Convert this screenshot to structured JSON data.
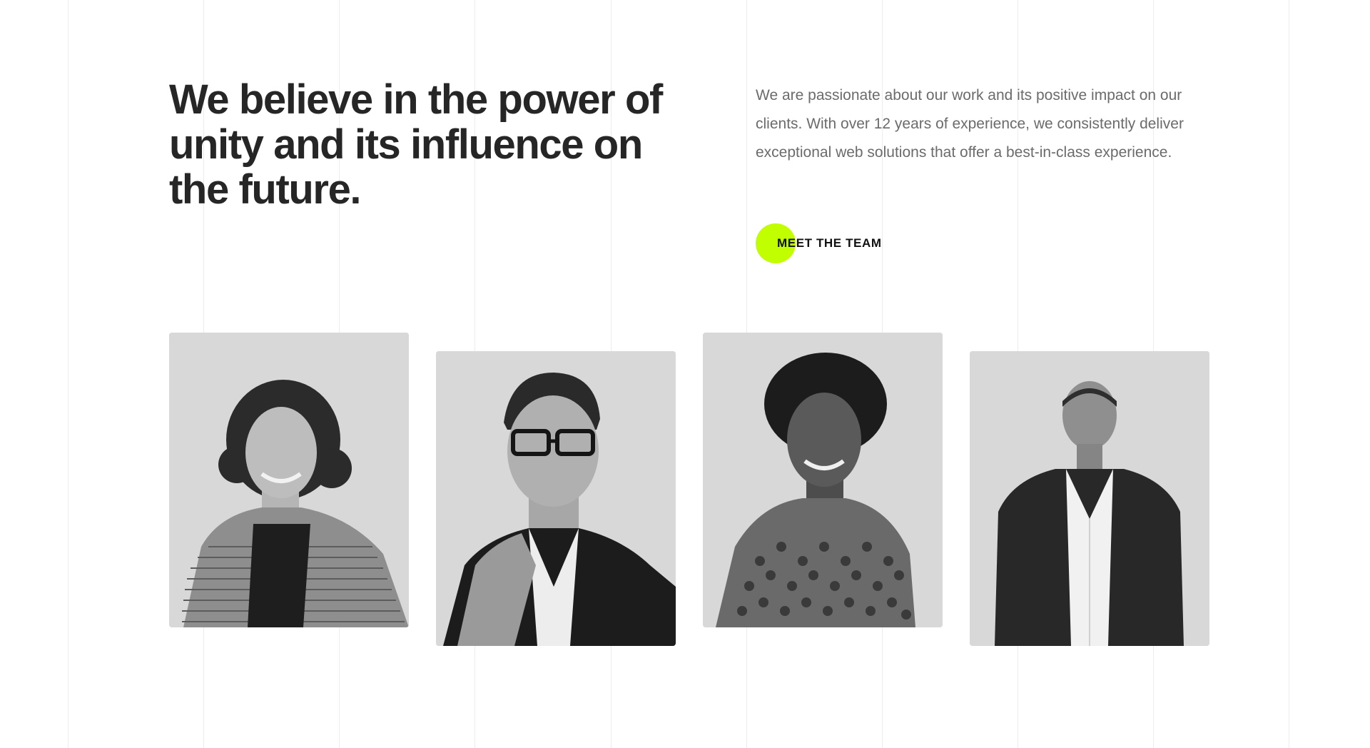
{
  "headline": "We believe in the power of unity and its influence on the future.",
  "intro": "We are passionate about our work and its positive impact on our clients. With over 12 years of experience, we consistently deliver exceptional web solutions that offer a best-in-class experience.",
  "cta": {
    "label": "MEET THE TEAM",
    "accent_color": "#c1ff00"
  },
  "colors": {
    "heading": "#262626",
    "body_text": "#6b6b6b",
    "photo_background": "#d8d8d8",
    "grid_line": "#ececec"
  }
}
